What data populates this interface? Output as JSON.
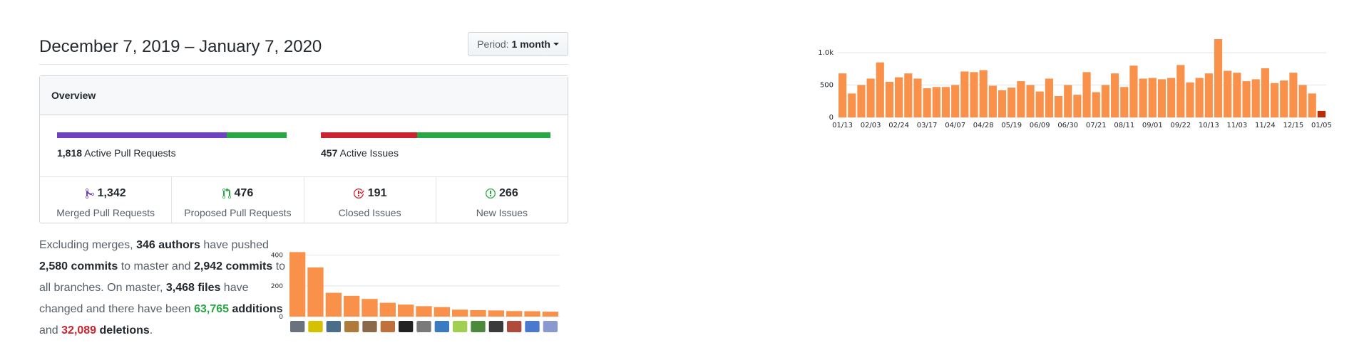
{
  "header": {
    "date_range": "December 7, 2019 – January 7, 2020",
    "period_label": "Period:",
    "period_value": "1 month"
  },
  "overview": {
    "title": "Overview",
    "pull_requests": {
      "count": "1,818",
      "label": "Active Pull Requests",
      "merged_fraction": 0.738,
      "colors": {
        "merged": "#6f42c1",
        "open": "#28a745"
      }
    },
    "issues": {
      "count": "457",
      "label": "Active Issues",
      "closed_fraction": 0.418,
      "colors": {
        "closed": "#cb2431",
        "open": "#28a745"
      }
    },
    "stats": [
      {
        "icon": "git-merge-icon",
        "value": "1,342",
        "label": "Merged Pull Requests",
        "color": "#6f42c1"
      },
      {
        "icon": "git-pull-request-icon",
        "value": "476",
        "label": "Proposed Pull Requests",
        "color": "#28a745"
      },
      {
        "icon": "issue-closed-icon",
        "value": "191",
        "label": "Closed Issues",
        "color": "#cb2431"
      },
      {
        "icon": "issue-opened-icon",
        "value": "266",
        "label": "New Issues",
        "color": "#28a745"
      }
    ]
  },
  "summary": {
    "p1": "Excluding merges, ",
    "authors": "346 authors",
    "p2": " have pushed ",
    "commits_master": "2,580 commits",
    "p3": " to master and ",
    "commits_all": "2,942 commits",
    "p4": " to all branches. On master, ",
    "files": "3,468 files",
    "p5": " have changed and there have been ",
    "additions_num": "63,765",
    "additions_word": " additions",
    "p6": " and ",
    "deletions_num": "32,089",
    "deletions_word": " deletions",
    "p7": "."
  },
  "colors": {
    "bar": "#f9914a",
    "bar_current": "#bd2c00",
    "grid": "#e1e4e8",
    "text": "#24292e"
  },
  "chart_data": [
    {
      "type": "bar",
      "yticks": [
        0,
        200,
        400
      ],
      "ylim": [
        0,
        440
      ],
      "values": [
        420,
        320,
        155,
        135,
        115,
        90,
        78,
        68,
        62,
        45,
        42,
        40,
        36,
        35,
        32
      ],
      "avatar_colors": [
        "#6a737d",
        "#d4c200",
        "#4a6e8a",
        "#b07a3a",
        "#8a6a4a",
        "#c0703a",
        "#222222",
        "#7a7a7a",
        "#3a7ac0",
        "#a0d050",
        "#4a8a3a",
        "#3a3a3a",
        "#b04a3a",
        "#4a7ad0",
        "#8a9ad0"
      ]
    },
    {
      "type": "bar",
      "yticks": [
        0,
        500,
        "1.0k"
      ],
      "ylim": [
        0,
        1100
      ],
      "xtick_labels": [
        "01/13",
        "02/03",
        "02/24",
        "03/17",
        "04/07",
        "04/28",
        "05/19",
        "06/09",
        "06/30",
        "07/21",
        "08/11",
        "09/01",
        "09/22",
        "10/13",
        "11/03",
        "11/24",
        "12/15",
        "01/05"
      ],
      "values": [
        680,
        370,
        500,
        600,
        850,
        550,
        620,
        680,
        600,
        450,
        470,
        470,
        500,
        710,
        700,
        730,
        490,
        420,
        460,
        560,
        500,
        400,
        600,
        330,
        500,
        350,
        700,
        390,
        500,
        680,
        470,
        800,
        600,
        610,
        590,
        610,
        810,
        540,
        610,
        680,
        1230,
        720,
        690,
        560,
        590,
        760,
        530,
        570,
        690,
        500,
        370,
        100
      ]
    }
  ]
}
